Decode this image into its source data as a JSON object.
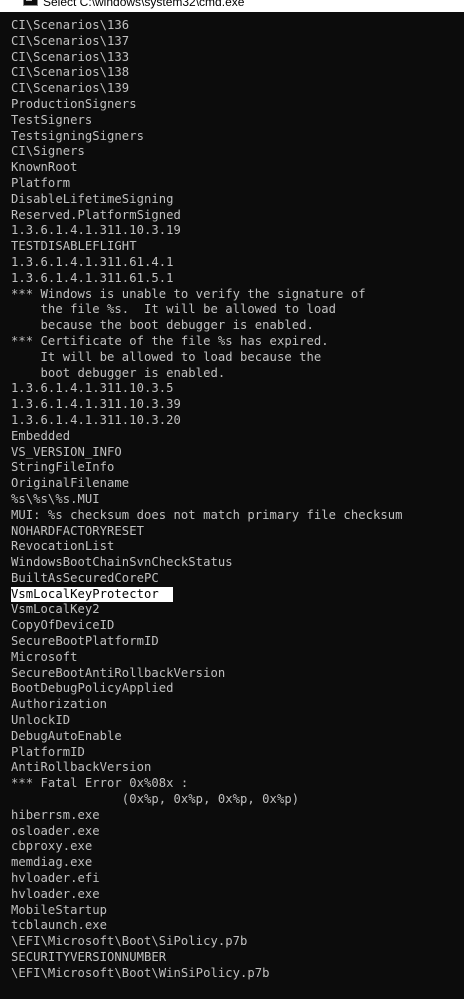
{
  "window": {
    "title": "Select C:\\windows\\system32\\cmd.exe",
    "icon": "cmd-icon"
  },
  "colors": {
    "background": "#0c0c0c",
    "text": "#c0c0c0",
    "selection_bg": "#ffffff",
    "selection_text": "#000000"
  },
  "console": {
    "selected_line_index": 36,
    "lines": [
      "CI\\Scenarios\\136",
      "CI\\Scenarios\\137",
      "CI\\Scenarios\\133",
      "CI\\Scenarios\\138",
      "CI\\Scenarios\\139",
      "ProductionSigners",
      "TestSigners",
      "TestsigningSigners",
      "CI\\Signers",
      "KnownRoot",
      "Platform",
      "DisableLifetimeSigning",
      "Reserved.PlatformSigned",
      "1.3.6.1.4.1.311.10.3.19",
      "TESTDISABLEFLIGHT",
      "1.3.6.1.4.1.311.61.4.1",
      "1.3.6.1.4.1.311.61.5.1",
      "*** Windows is unable to verify the signature of",
      "    the file %s.  It will be allowed to load",
      "    because the boot debugger is enabled.",
      "*** Certificate of the file %s has expired.",
      "    It will be allowed to load because the",
      "    boot debugger is enabled.",
      "1.3.6.1.4.1.311.10.3.5",
      "1.3.6.1.4.1.311.10.3.39",
      "1.3.6.1.4.1.311.10.3.20",
      "Embedded",
      "VS_VERSION_INFO",
      "StringFileInfo",
      "OriginalFilename",
      "%s\\%s\\%s.MUI",
      "MUI: %s checksum does not match primary file checksum",
      "NOHARDFACTORYRESET",
      "RevocationList",
      "WindowsBootChainSvnCheckStatus",
      "BuiltAsSecuredCorePC",
      "VsmLocalKeyProtector",
      "VsmLocalKey2",
      "CopyOfDeviceID",
      "SecureBootPlatformID",
      "Microsoft",
      "SecureBootAntiRollbackVersion",
      "BootDebugPolicyApplied",
      "Authorization",
      "UnlockID",
      "DebugAutoEnable",
      "PlatformID",
      "AntiRollbackVersion",
      "*** Fatal Error 0x%08x :",
      "               (0x%p, 0x%p, 0x%p, 0x%p)",
      "hiberrsm.exe",
      "osloader.exe",
      "cbproxy.exe",
      "memdiag.exe",
      "hvloader.efi",
      "hvloader.exe",
      "MobileStartup",
      "tcblaunch.exe",
      "\\EFI\\Microsoft\\Boot\\SiPolicy.p7b",
      "SECURITYVERSIONNUMBER",
      "\\EFI\\Microsoft\\Boot\\WinSiPolicy.p7b"
    ]
  }
}
